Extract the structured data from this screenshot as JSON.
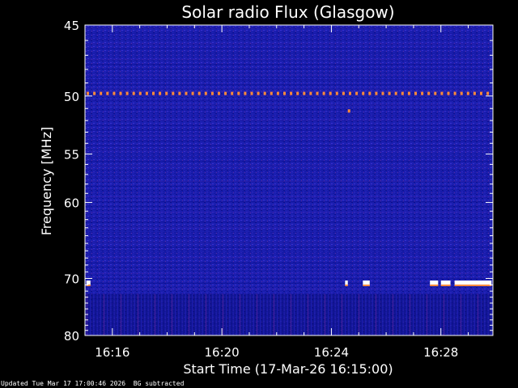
{
  "chart_data": {
    "type": "heatmap",
    "title": "Solar radio Flux (Glasgow)",
    "xlabel": "Start Time (17-Mar-26 16:15:00)",
    "ylabel": "Frequency [MHz]",
    "x_ticks": [
      "16:16",
      "16:20",
      "16:24",
      "16:28"
    ],
    "x_tick_minutes": [
      16,
      20,
      24,
      28
    ],
    "xlim_minutes": [
      15,
      29.9
    ],
    "y_ticks": [
      45,
      50,
      55,
      60,
      70,
      80
    ],
    "ylim": [
      45,
      80
    ],
    "y_scale": "reciprocal",
    "colors": {
      "background": "#1a1fa6",
      "low": "#1010c0",
      "mid": "#7a1a9a",
      "high": "#ff8a3a",
      "max": "#ffffff"
    },
    "bright_lines": [
      {
        "frequency": 49.8,
        "pattern": "periodic dashes across full time range"
      },
      {
        "frequency": 70.7,
        "pattern": "intermittent bursts, strongest after 16:28"
      }
    ]
  },
  "footer": {
    "updated": "Updated Tue Mar 17 17:00:46 2026",
    "note": "BG subtracted"
  }
}
